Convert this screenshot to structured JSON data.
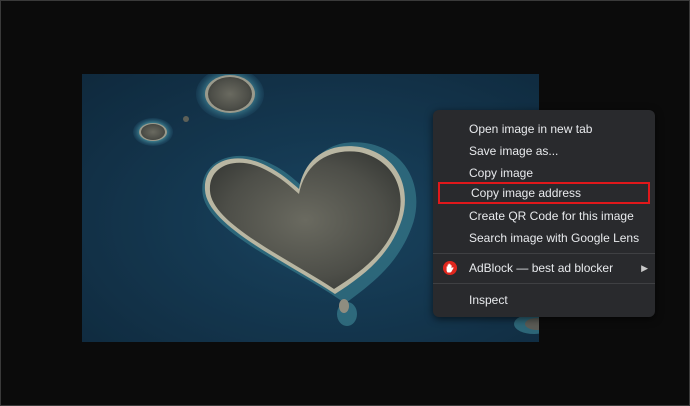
{
  "context_menu": {
    "items": [
      {
        "label": "Open image in new tab"
      },
      {
        "label": "Save image as..."
      },
      {
        "label": "Copy image"
      },
      {
        "label": "Copy image address"
      },
      {
        "label": "Create QR Code for this image"
      },
      {
        "label": "Search image with Google Lens"
      }
    ],
    "extension": {
      "label": "AdBlock — best ad blocker",
      "icon": "adblock-hand-icon",
      "color": "#e0271e"
    },
    "inspect": "Inspect",
    "submenu_arrow": "▶"
  },
  "colors": {
    "menu_bg": "#292a2d",
    "highlight_border": "#e0181b",
    "page_bg": "#0b0b0b"
  }
}
